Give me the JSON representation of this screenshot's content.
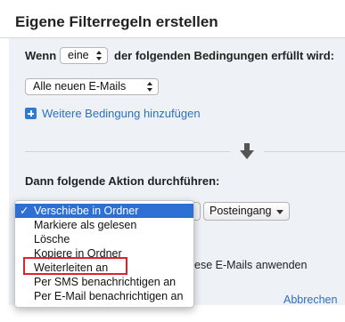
{
  "dialog": {
    "title": "Eigene Filterregeln erstellen"
  },
  "condition": {
    "prefix": "Wenn",
    "match_select": "eine",
    "suffix": "der folgenden Bedingungen erfüllt wird:",
    "message_select": "Alle neuen E-Mails",
    "add_condition_link": "Weitere Bedingung hinzufügen"
  },
  "action": {
    "heading": "Dann folgende Aktion durchführen:",
    "folder_button": "Posteingang",
    "menu": {
      "items": [
        {
          "label": "Verschiebe in Ordner",
          "selected": true,
          "check": "✓"
        },
        {
          "label": "Markiere als gelesen",
          "selected": false,
          "check": ""
        },
        {
          "label": "Lösche",
          "selected": false,
          "check": ""
        },
        {
          "label": "Kopiere in Ordner",
          "selected": false,
          "check": ""
        },
        {
          "label": "Weiterleiten an",
          "selected": false,
          "check": ""
        },
        {
          "label": "Per SMS benachrichtigen an",
          "selected": false,
          "check": ""
        },
        {
          "label": "Per E-Mail benachrichtigen an",
          "selected": false,
          "check": ""
        }
      ]
    },
    "apply_text_partial": "ese E-Mails anwenden"
  },
  "footer": {
    "cancel_label": "Abbrechen"
  },
  "colors": {
    "accent": "#2d6fd2",
    "link": "#2f6fbf",
    "highlight": "#e0202a"
  }
}
